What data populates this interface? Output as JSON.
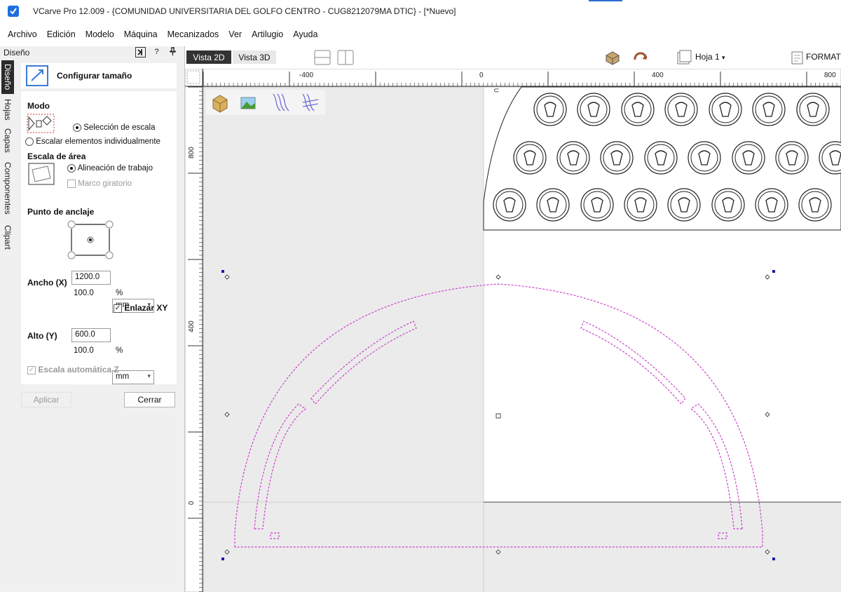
{
  "window": {
    "title": "VCarve Pro 12.009 - {COMUNIDAD UNIVERSITARIA DEL GOLFO CENTRO - CUG8212079MA DTIC} - [*Nuevo]"
  },
  "menu": [
    "Archivo",
    "Edición",
    "Modelo",
    "Máquina",
    "Mecanizados",
    "Ver",
    "Artilugio",
    "Ayuda"
  ],
  "panel": {
    "title": "Diseño",
    "header_buttons": {
      "help": "?",
      "pin": "📌"
    },
    "vertical_tabs": [
      "Diseño",
      "Hojas",
      "Capas",
      "Componentes",
      "Clipart"
    ],
    "form": {
      "title": "Configurar tamaño",
      "modo_label": "Modo",
      "modo_options": [
        "Selección de escala",
        "Escalar elementos individualmente"
      ],
      "area_label": "Escala de área",
      "area_options": [
        "Alineación de trabajo",
        "Marco giratorio"
      ],
      "anchor_label": "Punto de anclaje",
      "width_label": "Ancho (X)",
      "width_value": "1200.0",
      "width_unit": "mm",
      "width_percent": "100.0",
      "percent_symbol": "%",
      "link_xy": "Enlazar XY",
      "height_label": "Alto (Y)",
      "height_value": "600.0",
      "height_unit": "mm",
      "height_percent": "100.0",
      "auto_z": "Escala automática Z",
      "apply": "Aplicar",
      "close": "Cerrar"
    }
  },
  "view_tabs": {
    "v2d": "Vista 2D",
    "v3d": "Vista 3D"
  },
  "sheet": {
    "label": "Hoja 1",
    "format": "FORMAT"
  },
  "rulers": {
    "horizontal": [
      "-400",
      "0",
      "400",
      "800"
    ],
    "vertical": [
      "800",
      "400",
      "0"
    ]
  },
  "colors": {
    "accent": "#2b6cd0",
    "selection": "#cc44cc",
    "handle": "#1a1aa8"
  }
}
